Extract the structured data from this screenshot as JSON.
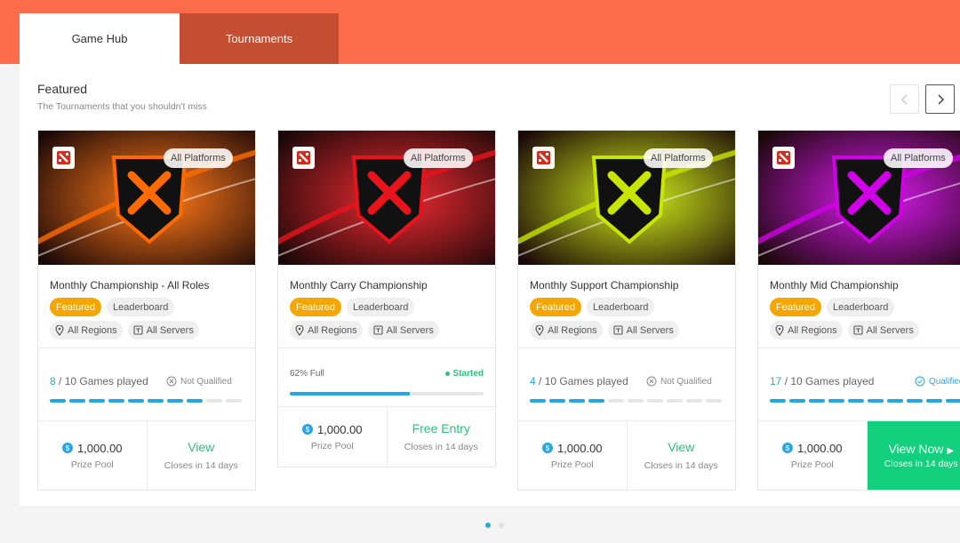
{
  "tabs": {
    "hub": "Game Hub",
    "tournaments": "Tournaments"
  },
  "section": {
    "title": "Featured",
    "subtitle": "The Tournaments that you shouldn't miss"
  },
  "cards": [
    {
      "title": "Monthly Championship - All Roles",
      "platform": "All Platforms",
      "tag_featured": "Featured",
      "tag_board": "Leaderboard",
      "regions": "All Regions",
      "servers": "All Servers",
      "games_count": "8",
      "games_text": "/ 10 Games played",
      "games_progress": 8,
      "qualification": "Not Qualified",
      "prize": "1,000.00",
      "prize_label": "Prize Pool",
      "action": "View",
      "closes": "Closes in 14 days",
      "accent": "#ff6a00"
    },
    {
      "title": "Monthly Carry Championship",
      "platform": "All Platforms",
      "tag_featured": "Featured",
      "tag_board": "Leaderboard",
      "regions": "All Regions",
      "servers": "All Servers",
      "full_text": "62% Full",
      "full_progress": 62,
      "status": "Started",
      "prize": "1,000.00",
      "prize_label": "Prize Pool",
      "action": "Free Entry",
      "closes": "Closes in 14 days",
      "accent": "#e8131b"
    },
    {
      "title": "Monthly Support Championship",
      "platform": "All Platforms",
      "tag_featured": "Featured",
      "tag_board": "Leaderboard",
      "regions": "All Regions",
      "servers": "All Servers",
      "games_count": "4",
      "games_text": "/ 10 Games played",
      "games_progress": 4,
      "qualification": "Not Qualified",
      "prize": "1,000.00",
      "prize_label": "Prize Pool",
      "action": "View",
      "closes": "Closes in 14 days",
      "accent": "#c8e600"
    },
    {
      "title": "Monthly Mid Championship",
      "platform": "All Platforms",
      "tag_featured": "Featured",
      "tag_board": "Leaderboard",
      "regions": "All Regions",
      "servers": "All Servers",
      "games_count": "17",
      "games_text": "/ 10 Games played",
      "games_progress": 10,
      "qualification": "Qualified",
      "prize": "1,000.00",
      "prize_label": "Prize Pool",
      "action": "View Now",
      "closes": "Closes in 14 days",
      "accent": "#d100e8"
    }
  ],
  "colors": {
    "brand": "#fc6c4b",
    "tab_active": "#c44e32",
    "accent_blue": "#27a6e3",
    "accent_green": "#12d07e",
    "featured": "#f7a600"
  },
  "pager": {
    "total": 2,
    "active": 0
  }
}
